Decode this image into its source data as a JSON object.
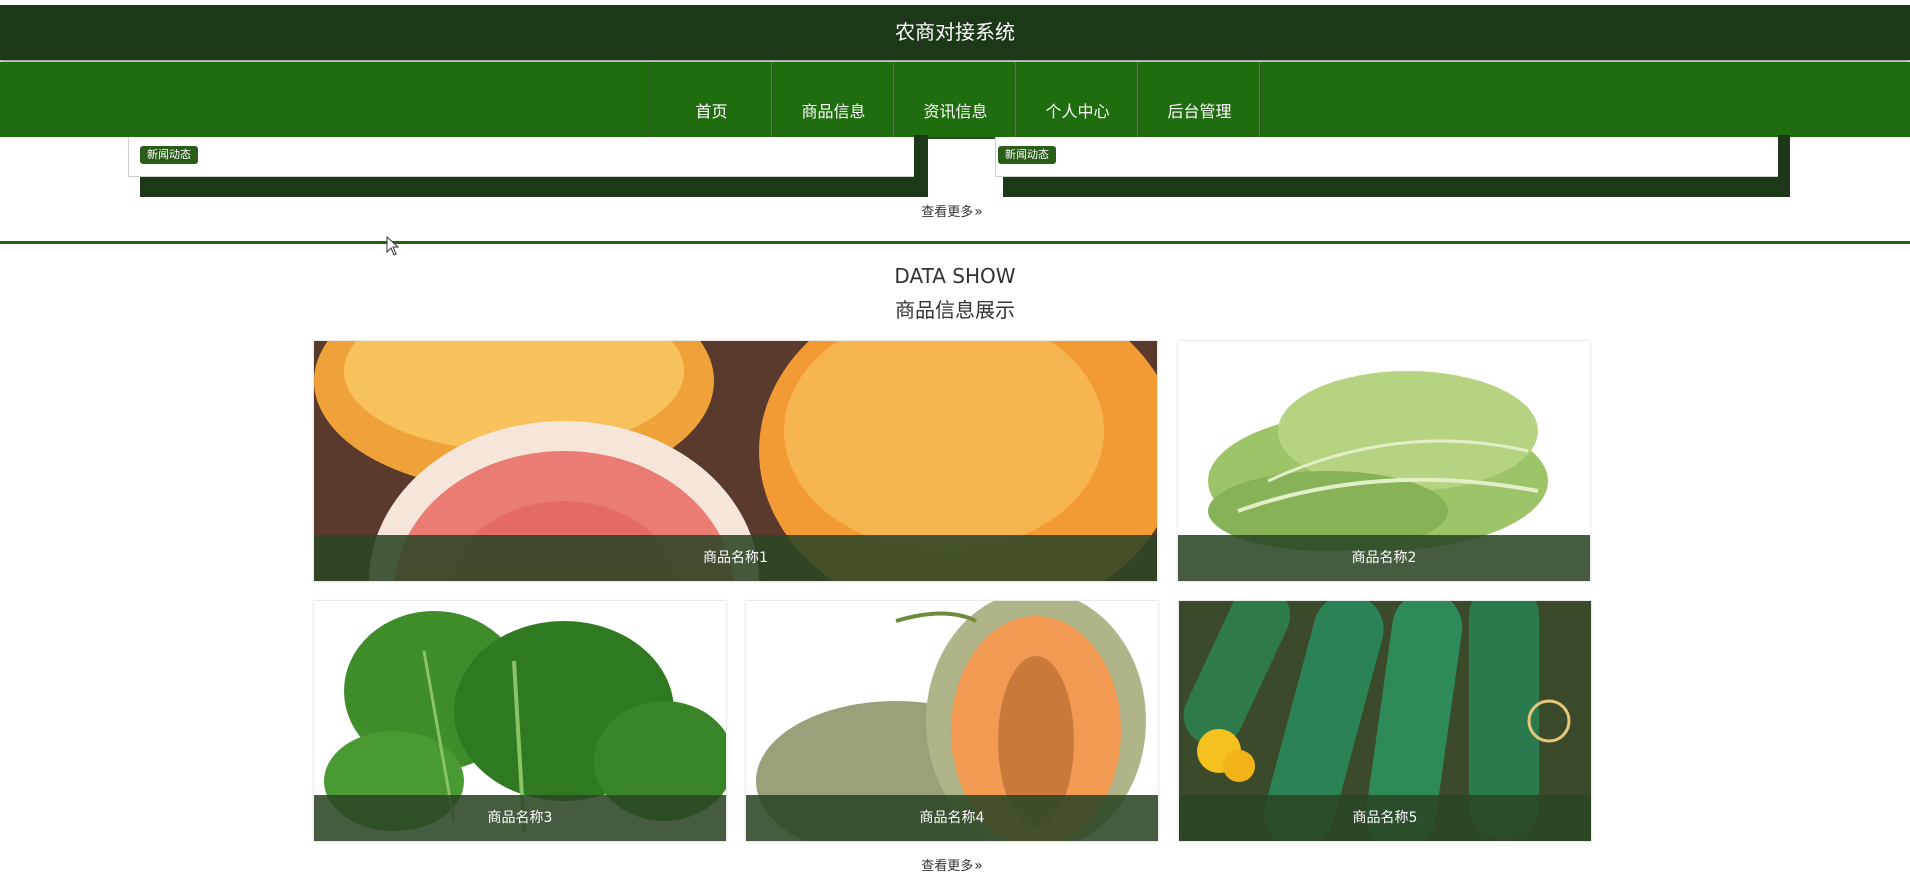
{
  "header": {
    "title": "农商对接系统"
  },
  "nav": {
    "items": [
      {
        "label": "首页"
      },
      {
        "label": "商品信息"
      },
      {
        "label": "资讯信息"
      },
      {
        "label": "个人中心"
      },
      {
        "label": "后台管理"
      }
    ]
  },
  "news": {
    "badge_label": "新闻动态",
    "more_label": "查看更多"
  },
  "products": {
    "title_en": "DATA SHOW",
    "title_zh": "商品信息展示",
    "items": [
      {
        "name": "商品名称1",
        "image": "grapefruit"
      },
      {
        "name": "商品名称2",
        "image": "lettuce"
      },
      {
        "name": "商品名称3",
        "image": "spinach"
      },
      {
        "name": "商品名称4",
        "image": "cantaloupe"
      },
      {
        "name": "商品名称5",
        "image": "cucumber"
      }
    ],
    "more_label": "查看更多"
  },
  "colors": {
    "header_bg": "#1c3818",
    "nav_bg": "#1f6d0f",
    "accent": "#2a5d1a"
  }
}
